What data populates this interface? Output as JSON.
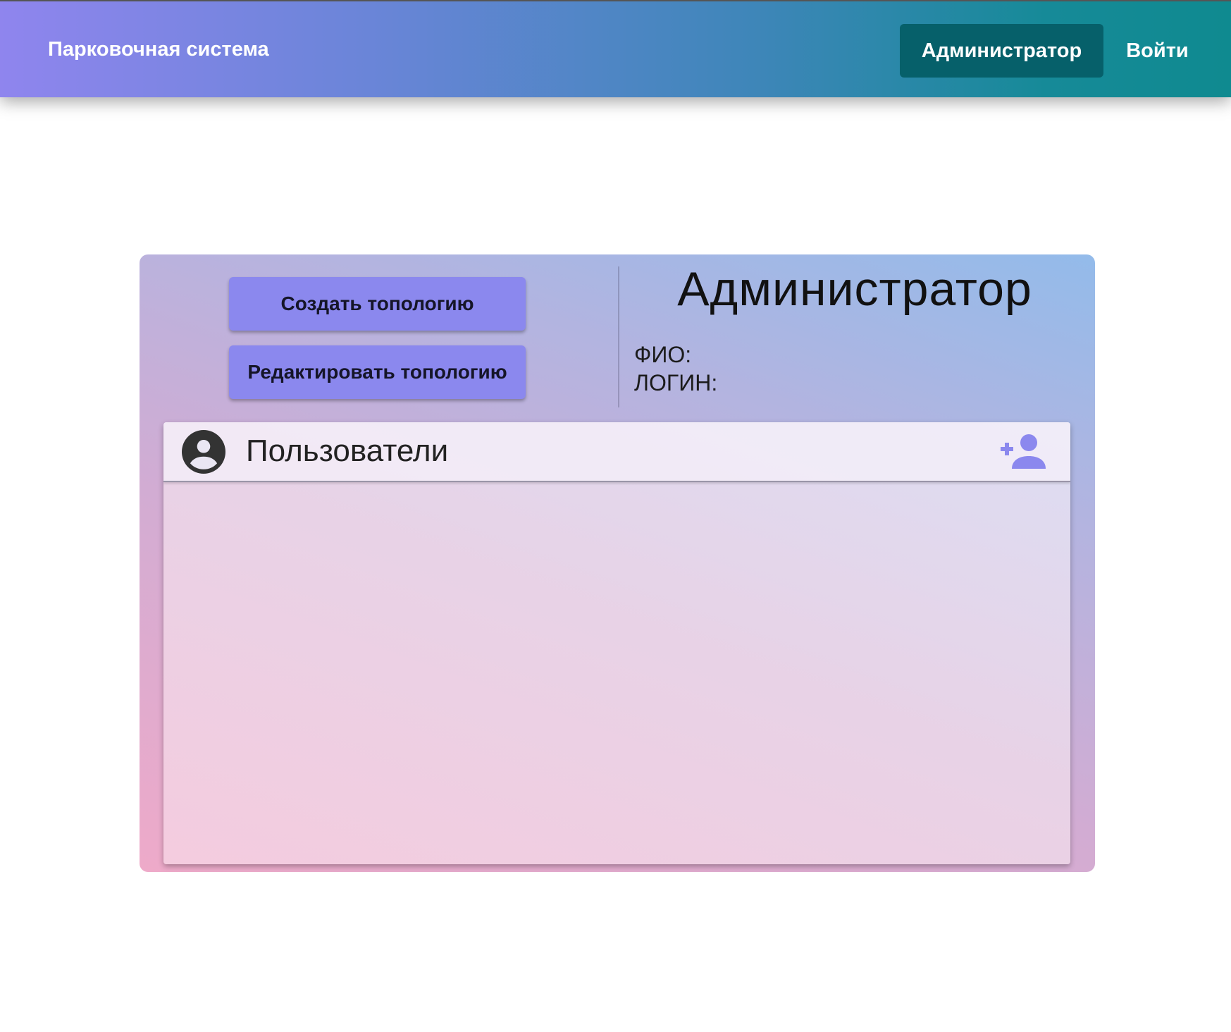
{
  "header": {
    "app_title": "Парковочная система",
    "nav": {
      "admin_label": "Администратор",
      "login_label": "Войти"
    }
  },
  "actions": {
    "create_topology_label": "Создать топологию",
    "edit_topology_label": "Редактировать топологию"
  },
  "profile": {
    "role_title": "Администратор",
    "fio_label": "ФИО:",
    "login_label": "ЛОГИН:"
  },
  "users": {
    "title": "Пользователи",
    "header_icon": "account-circle-icon",
    "add_icon": "person-add-icon",
    "items": []
  },
  "colors": {
    "appbar_gradient_start": "#8f85ee",
    "appbar_gradient_end": "#0f8a90",
    "nav_active_bg": "#06606a",
    "button_bg": "#8b88ee",
    "add_user_icon": "#8b88ee"
  }
}
